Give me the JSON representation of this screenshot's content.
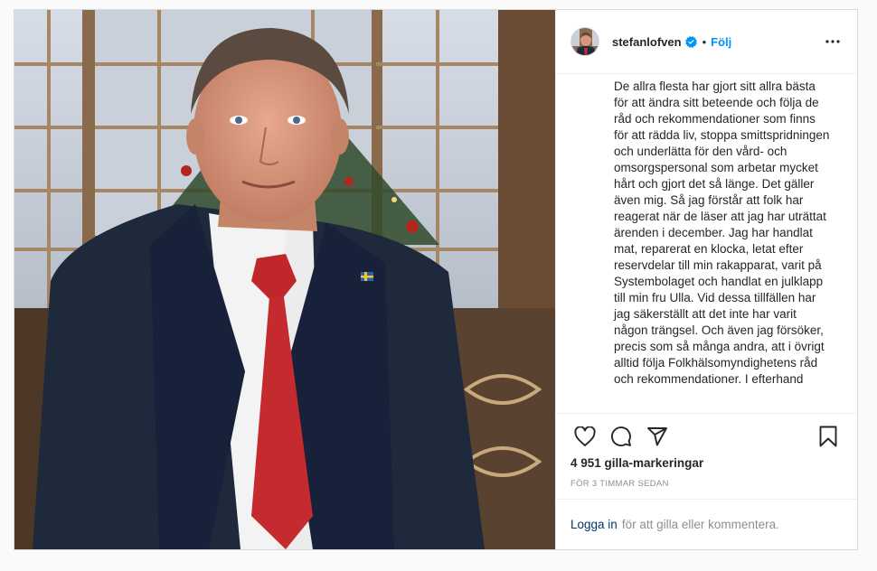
{
  "post": {
    "username": "stefanlofven",
    "dot": "•",
    "follow_label": "Följ",
    "caption": "De allra flesta har gjort sitt allra bästa för att ändra sitt beteende och följa de råd och rekommendationer som finns för att rädda liv, stoppa smittspridningen och underlätta för den vård- och omsorgspersonal som arbetar mycket hårt och gjort det så länge. Det gäller även mig. Så jag förstår att folk har reagerat när de läser att jag har uträttat ärenden i december. Jag har handlat mat, reparerat en klocka, letat efter reservdelar till min rakapparat, varit på Systembolaget och handlat en julklapp till min fru Ulla. Vid dessa tillfällen har jag säkerställt att det inte har varit någon trängsel. Och även jag försöker, precis som så många andra, att i övrigt alltid följa Folkhälsomyndighetens råd och rekommendationer. I efterhand",
    "likes": "4 951 gilla-markeringar",
    "time": "FÖR 3 TIMMAR SEDAN",
    "login_link": "Logga in",
    "login_rest": "för att gilla eller kommentera."
  },
  "icons": {
    "verified": "verified-badge-icon",
    "more": "more-options-icon",
    "like": "heart-icon",
    "comment": "comment-icon",
    "share": "send-icon",
    "save": "bookmark-icon"
  },
  "colors": {
    "accent": "#0095f6",
    "link": "#00376b",
    "muted": "#8e8e8e",
    "border": "#dbdbdb"
  }
}
